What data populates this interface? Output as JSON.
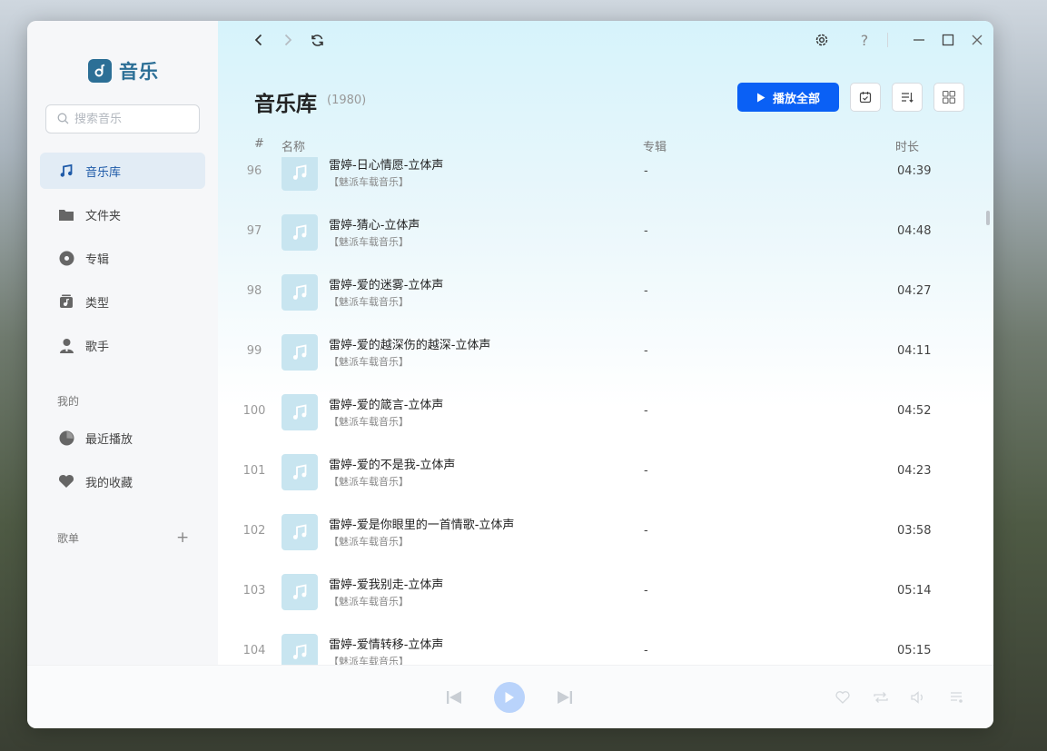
{
  "app": {
    "name": "音乐"
  },
  "search": {
    "placeholder": "搜索音乐"
  },
  "sidebar": {
    "items": [
      {
        "label": "音乐库",
        "icon": "music-note-icon"
      },
      {
        "label": "文件夹",
        "icon": "folder-icon"
      },
      {
        "label": "专辑",
        "icon": "album-disc-icon"
      },
      {
        "label": "类型",
        "icon": "genre-icon"
      },
      {
        "label": "歌手",
        "icon": "singer-icon"
      }
    ],
    "mine_label": "我的",
    "mine_items": [
      {
        "label": "最近播放",
        "icon": "recent-clock-icon"
      },
      {
        "label": "我的收藏",
        "icon": "heart-icon"
      }
    ],
    "playlist_label": "歌单",
    "add_symbol": "+"
  },
  "header": {
    "title": "音乐库",
    "count": "(1980)",
    "play_all_label": "播放全部"
  },
  "table": {
    "columns": {
      "index": "#",
      "name": "名称",
      "album": "专辑",
      "duration": "时长"
    },
    "rows": [
      {
        "index": "96",
        "song": "雷婷-日心情愿-立体声",
        "artist": "【魅派车载音乐】",
        "album": "-",
        "duration": "04:39"
      },
      {
        "index": "97",
        "song": "雷婷-猜心-立体声",
        "artist": "【魅派车载音乐】",
        "album": "-",
        "duration": "04:48"
      },
      {
        "index": "98",
        "song": "雷婷-爱的迷雾-立体声",
        "artist": "【魅派车载音乐】",
        "album": "-",
        "duration": "04:27"
      },
      {
        "index": "99",
        "song": "雷婷-爱的越深伤的越深-立体声",
        "artist": "【魅派车载音乐】",
        "album": "-",
        "duration": "04:11"
      },
      {
        "index": "100",
        "song": "雷婷-爱的箴言-立体声",
        "artist": "【魅派车载音乐】",
        "album": "-",
        "duration": "04:52"
      },
      {
        "index": "101",
        "song": "雷婷-爱的不是我-立体声",
        "artist": "【魅派车载音乐】",
        "album": "-",
        "duration": "04:23"
      },
      {
        "index": "102",
        "song": "雷婷-爱是你眼里的一首情歌-立体声",
        "artist": "【魅派车载音乐】",
        "album": "-",
        "duration": "03:58"
      },
      {
        "index": "103",
        "song": "雷婷-爱我别走-立体声",
        "artist": "【魅派车载音乐】",
        "album": "-",
        "duration": "05:14"
      },
      {
        "index": "104",
        "song": "雷婷-爱情转移-立体声",
        "artist": "【魅派车载音乐】",
        "album": "-",
        "duration": "05:15"
      }
    ]
  },
  "colors": {
    "accent": "#0a60f5",
    "brand": "#2c6f96",
    "active_bg": "#e2ecf5"
  }
}
